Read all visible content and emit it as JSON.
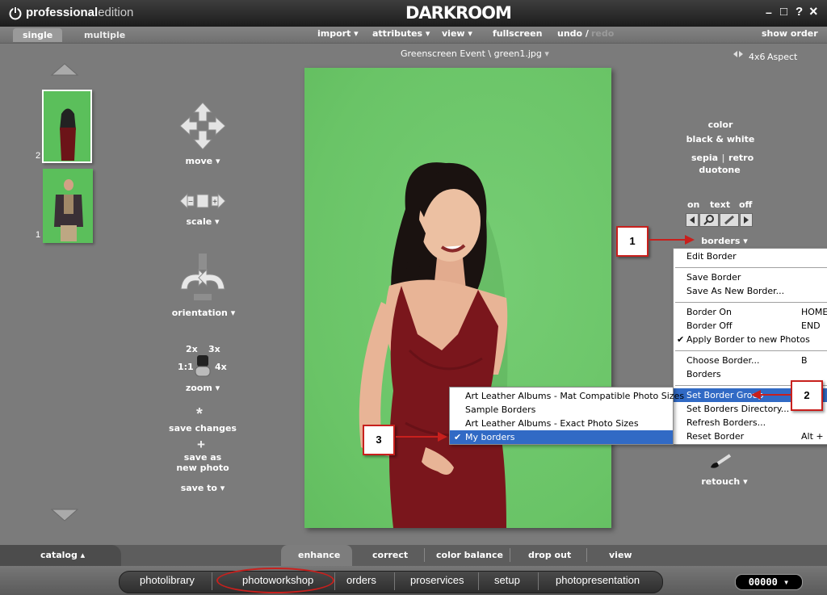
{
  "titlebar": {
    "brand_bold": "professional",
    "brand_light": "edition",
    "logo": "DARKROOM",
    "window_controls": [
      "–",
      "□",
      "?",
      "×"
    ]
  },
  "menubar": {
    "tabs": [
      "single",
      "multiple"
    ],
    "items": [
      "import ▾",
      "attributes ▾",
      "view ▾",
      "fullscreen",
      "undo /",
      "redo"
    ],
    "show_order": "show order"
  },
  "breadcrumb": "Greenscreen Event \\ green1.jpg",
  "aspect": {
    "size": "4x6",
    "label": "Aspect"
  },
  "thumbnails": [
    {
      "number": "2"
    },
    {
      "number": "1"
    }
  ],
  "tools": {
    "move": "move ▾",
    "scale": "scale ▾",
    "orientation": "orientation ▾",
    "zoom_labels": {
      "z2x": "2x",
      "z3x": "3x",
      "z1": "1:1",
      "z4x": "4x"
    },
    "zoom": "zoom ▾",
    "save_changes": "save changes",
    "save_as": "save as",
    "new_photo": "new photo",
    "save_to": "save to ▾"
  },
  "color_modes": {
    "color": "color",
    "bw": "black & white",
    "sepia": "sepia",
    "divider": "|",
    "retro": "retro",
    "duotone": "duotone"
  },
  "text_controls": {
    "on": "on",
    "text": "text",
    "off": "off"
  },
  "borders_label": "borders ▾",
  "retouch_label": "retouch ▾",
  "border_menu": {
    "items": [
      {
        "label": "Edit Border"
      },
      {
        "label": "Save Border"
      },
      {
        "label": "Save As New Border..."
      },
      {
        "label": "Border On",
        "shortcut": "HOME"
      },
      {
        "label": "Border Off",
        "shortcut": "END"
      },
      {
        "label": "Apply Border to new Photos",
        "checked": "✔"
      },
      {
        "label": "Choose Border...",
        "shortcut": "B"
      },
      {
        "label": "Borders"
      },
      {
        "label": "Set Border Group"
      },
      {
        "label": "Set Borders Directory..."
      },
      {
        "label": "Refresh Borders..."
      },
      {
        "label": "Reset Border",
        "shortcut": "Alt + R"
      }
    ]
  },
  "group_menu": {
    "items": [
      {
        "label": "Art Leather Albums - Mat Compatible Photo Sizes"
      },
      {
        "label": "Sample Borders"
      },
      {
        "label": "Art Leather Albums - Exact Photo Sizes"
      },
      {
        "label": "My borders",
        "checked": "✔"
      }
    ]
  },
  "callouts": [
    "1",
    "2",
    "3"
  ],
  "bottom_tabs": {
    "catalog": "catalog ▴",
    "tabs": [
      "enhance",
      "correct",
      "color balance",
      "drop out",
      "view"
    ]
  },
  "dock": {
    "items": [
      "photolibrary",
      "photoworkshop",
      "orders",
      "proservices",
      "setup",
      "photopresentation"
    ],
    "counter": "00000 ▾"
  },
  "colors": {
    "accent": "#316ac5",
    "callout": "#c8201d",
    "greenscreen": "#6fc86d"
  }
}
